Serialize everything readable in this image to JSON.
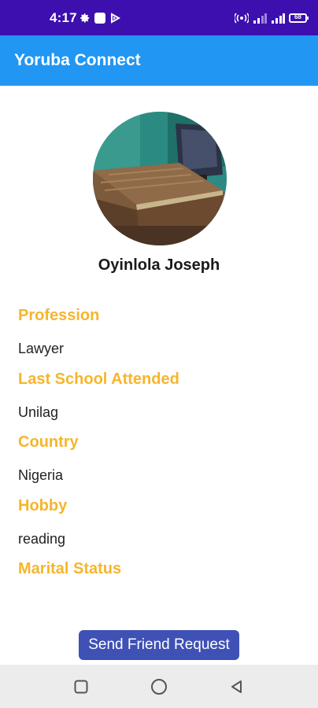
{
  "status_bar": {
    "time": "4:17",
    "battery": "68",
    "left_icons": [
      "gear-icon",
      "square-icon",
      "play-icon"
    ],
    "right_icons": [
      "hotspot-icon",
      "signal-icon",
      "signal-icon",
      "battery-icon"
    ]
  },
  "app_bar": {
    "title": "Yoruba Connect"
  },
  "profile": {
    "name": "Oyinlola Joseph",
    "fields": [
      {
        "label": "Profession",
        "value": "Lawyer"
      },
      {
        "label": "Last School Attended",
        "value": "Unilag"
      },
      {
        "label": "Country",
        "value": "Nigeria"
      },
      {
        "label": "Hobby",
        "value": "reading"
      },
      {
        "label": "Marital Status",
        "value": ""
      }
    ]
  },
  "actions": {
    "send_friend_request": "Send Friend Request"
  },
  "nav": [
    "recents-square-icon",
    "home-circle-icon",
    "back-triangle-icon"
  ],
  "colors": {
    "status_bar": "#3c0fae",
    "app_bar": "#2196f3",
    "label": "#f6b52c",
    "button": "#3f51b5"
  }
}
